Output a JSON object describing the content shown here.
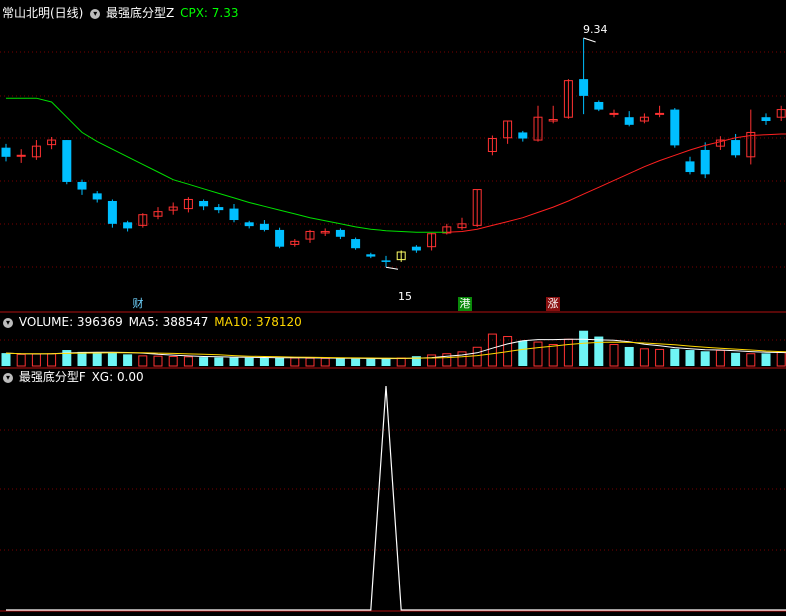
{
  "header": {
    "stock": "常山北明(日线)",
    "indicator": "最强底分型Z",
    "cpx_label": "CPX: 7.33"
  },
  "annotations": {
    "high": "9.34",
    "low": "15"
  },
  "badges": {
    "cai": "财",
    "gang": "港",
    "zhang": "涨"
  },
  "volume_header": {
    "name": "VOLUME: 396369",
    "ma5": "MA5: 388547",
    "ma10": "MA10: 378120"
  },
  "xg_header": {
    "name": "最强底分型F",
    "value": "XG: 0.00"
  },
  "colors": {
    "up": "#ff3232",
    "down": "#00bfff",
    "ma": "#00e000",
    "ma_right": "#ff2020",
    "ma5": "#ffffff",
    "ma10": "#ffd700",
    "grid": "#7a0000",
    "border": "#b01010"
  },
  "chart_data": [
    {
      "type": "candlestick",
      "title": "常山北明(日线)",
      "ylim": [
        5.9,
        9.55
      ],
      "series": [
        {
          "name": "candles",
          "values": [
            [
              7.9,
              7.78,
              7.72,
              7.95
            ],
            [
              7.8,
              7.8,
              7.7,
              7.88
            ],
            [
              7.78,
              7.92,
              7.74,
              8.0
            ],
            [
              7.94,
              8.0,
              7.88,
              8.04
            ],
            [
              8.0,
              7.45,
              7.42,
              8.0
            ],
            [
              7.45,
              7.35,
              7.28,
              7.48
            ],
            [
              7.3,
              7.22,
              7.18,
              7.33
            ],
            [
              7.2,
              6.9,
              6.85,
              7.22
            ],
            [
              6.92,
              6.84,
              6.8,
              6.94
            ],
            [
              6.88,
              7.02,
              6.85,
              7.04
            ],
            [
              7.0,
              7.06,
              6.96,
              7.12
            ],
            [
              7.08,
              7.12,
              7.02,
              7.18
            ],
            [
              7.1,
              7.22,
              7.05,
              7.25
            ],
            [
              7.2,
              7.13,
              7.08,
              7.22
            ],
            [
              7.12,
              7.08,
              7.04,
              7.16
            ],
            [
              7.1,
              6.95,
              6.92,
              7.16
            ],
            [
              6.92,
              6.87,
              6.84,
              6.94
            ],
            [
              6.9,
              6.82,
              6.8,
              6.95
            ],
            [
              6.82,
              6.6,
              6.58,
              6.85
            ],
            [
              6.63,
              6.67,
              6.6,
              6.7
            ],
            [
              6.7,
              6.8,
              6.65,
              6.82
            ],
            [
              6.78,
              6.8,
              6.74,
              6.84
            ],
            [
              6.82,
              6.73,
              6.7,
              6.84
            ],
            [
              6.7,
              6.58,
              6.56,
              6.72
            ],
            [
              6.5,
              6.47,
              6.45,
              6.52
            ],
            [
              6.42,
              6.4,
              6.33,
              6.48
            ],
            [
              6.43,
              6.53,
              6.4,
              6.55
            ],
            [
              6.6,
              6.55,
              6.52,
              6.62
            ],
            [
              6.6,
              6.77,
              6.55,
              6.78
            ],
            [
              6.78,
              6.86,
              6.76,
              6.9
            ],
            [
              6.85,
              6.9,
              6.82,
              6.98
            ],
            [
              6.88,
              7.35,
              6.86,
              7.35
            ],
            [
              7.85,
              8.02,
              7.8,
              8.06
            ],
            [
              8.03,
              8.25,
              7.95,
              8.25
            ],
            [
              8.1,
              8.02,
              7.98,
              8.12
            ],
            [
              8.0,
              8.3,
              7.98,
              8.45
            ],
            [
              8.25,
              8.27,
              8.22,
              8.45
            ],
            [
              8.3,
              8.78,
              8.28,
              8.8
            ],
            [
              8.8,
              8.58,
              8.34,
              9.34
            ],
            [
              8.5,
              8.4,
              8.38,
              8.52
            ],
            [
              8.35,
              8.35,
              8.3,
              8.4
            ],
            [
              8.3,
              8.2,
              8.18,
              8.38
            ],
            [
              8.25,
              8.3,
              8.22,
              8.35
            ],
            [
              8.35,
              8.35,
              8.3,
              8.45
            ],
            [
              8.4,
              7.93,
              7.9,
              8.42
            ],
            [
              7.72,
              7.58,
              7.55,
              7.78
            ],
            [
              7.87,
              7.55,
              7.5,
              7.97
            ],
            [
              7.92,
              8.0,
              7.87,
              8.05
            ],
            [
              8.0,
              7.8,
              7.77,
              8.08
            ],
            [
              7.78,
              8.1,
              7.68,
              8.4
            ],
            [
              8.3,
              8.25,
              8.2,
              8.35
            ],
            [
              8.3,
              8.4,
              8.25,
              8.45
            ],
            [
              8.4,
              8.1,
              8.05,
              8.45
            ]
          ]
        },
        {
          "name": "MA",
          "values": [
            8.55,
            8.55,
            8.55,
            8.5,
            8.3,
            8.1,
            7.98,
            7.88,
            7.78,
            7.68,
            7.58,
            7.48,
            7.42,
            7.36,
            7.3,
            7.24,
            7.18,
            7.13,
            7.08,
            7.03,
            6.98,
            6.94,
            6.9,
            6.86,
            6.83,
            6.81,
            6.8,
            6.79,
            6.79,
            6.79,
            6.8,
            6.83,
            6.88,
            6.93,
            6.98,
            7.05,
            7.12,
            7.2,
            7.29,
            7.38,
            7.47,
            7.56,
            7.65,
            7.73,
            7.8,
            7.87,
            7.93,
            7.98,
            8.03,
            8.06,
            8.07,
            8.08,
            8.08
          ]
        }
      ]
    },
    {
      "type": "bar",
      "title": "VOLUME",
      "series": [
        {
          "name": "VOLUME",
          "values": [
            420000,
            380000,
            390000,
            400000,
            520000,
            460000,
            430000,
            450000,
            380000,
            330000,
            320000,
            310000,
            300000,
            290000,
            280000,
            275000,
            270000,
            265000,
            270000,
            260000,
            255000,
            250000,
            245000,
            240000,
            235000,
            230000,
            260000,
            320000,
            360000,
            400000,
            460000,
            610000,
            1040000,
            960000,
            820000,
            780000,
            700000,
            870000,
            1150000,
            960000,
            700000,
            620000,
            560000,
            540000,
            560000,
            520000,
            480000,
            510000,
            430000,
            400000,
            410000,
            450000,
            420000
          ]
        },
        {
          "name": "MA5",
          "values": [
            420000,
            400000,
            395000,
            400000,
            425000,
            440000,
            445000,
            450000,
            440000,
            420000,
            380000,
            355000,
            330000,
            310000,
            300000,
            290000,
            285000,
            278000,
            272000,
            268000,
            264000,
            260000,
            255000,
            250000,
            245000,
            240000,
            245000,
            255000,
            275000,
            315000,
            360000,
            430000,
            580000,
            720000,
            820000,
            860000,
            860000,
            870000,
            870000,
            850000,
            840000,
            790000,
            710000,
            660000,
            600000,
            560000,
            530000,
            520000,
            500000,
            470000,
            450000,
            440000,
            430000
          ]
        },
        {
          "name": "MA10",
          "values": [
            420000,
            400000,
            397000,
            398000,
            410000,
            420000,
            425000,
            430000,
            432000,
            430000,
            420000,
            410000,
            395000,
            380000,
            365000,
            340000,
            320000,
            310000,
            300000,
            290000,
            282000,
            276000,
            270000,
            265000,
            260000,
            256000,
            255000,
            258000,
            262000,
            275000,
            300000,
            340000,
            400000,
            470000,
            540000,
            600000,
            650000,
            700000,
            740000,
            770000,
            780000,
            770000,
            750000,
            720000,
            690000,
            650000,
            610000,
            580000,
            550000,
            520000,
            490000,
            470000,
            455000
          ]
        }
      ]
    },
    {
      "type": "line",
      "title": "最强底分型F",
      "series": [
        {
          "name": "XG",
          "values": [
            0,
            0,
            0,
            0,
            0,
            0,
            0,
            0,
            0,
            0,
            0,
            0,
            0,
            0,
            0,
            0,
            0,
            0,
            0,
            0,
            0,
            0,
            0,
            0,
            0,
            1,
            0,
            0,
            0,
            0,
            0,
            0,
            0,
            0,
            0,
            0,
            0,
            0,
            0,
            0,
            0,
            0,
            0,
            0,
            0,
            0,
            0,
            0,
            0,
            0,
            0,
            0,
            0
          ]
        }
      ]
    }
  ]
}
